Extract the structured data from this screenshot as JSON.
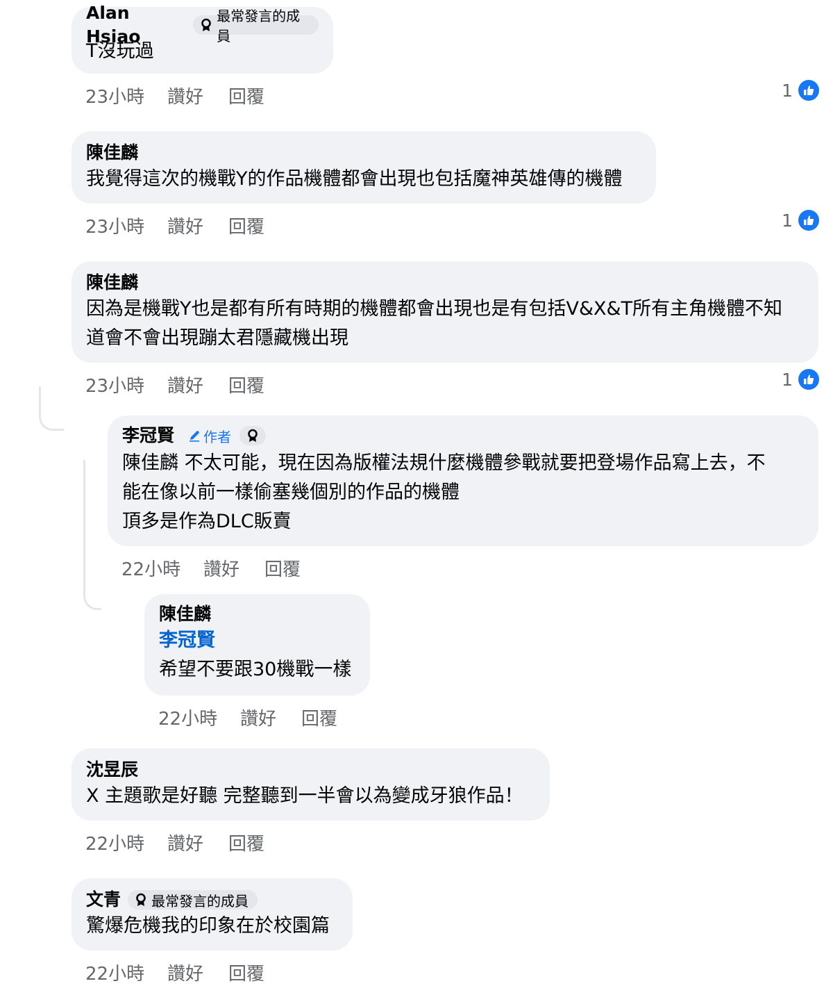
{
  "comments": [
    {
      "author": "Alan Hsiao",
      "badge": "最常發言的成員",
      "lines": "T沒玩過",
      "time": "23小時",
      "like": "讚好",
      "reply": "回覆",
      "reactions": "1"
    },
    {
      "author": "陳佳麟",
      "lines": "我覺得這次的機戰Y的作品機體都會出現也包括魔神英雄傳的機體",
      "time": "23小時",
      "like": "讚好",
      "reply": "回覆",
      "reactions": "1"
    },
    {
      "author": "陳佳麟",
      "lines": "因為是機戰Y也是都有所有時期的機體都會出現也是有包括V&X&T所有主角機體不知\n道會不會出現蹦太君隱藏機出現",
      "time": "23小時",
      "like": "讚好",
      "reply": "回覆",
      "reactions": "1"
    },
    {
      "author": "李冠賢",
      "author_badge": "作者",
      "lines": "陳佳麟 不太可能，現在因為版權法規什麼機體參戰就要把登場作品寫上去，不\n能在像以前一樣偷塞幾個別的作品的機體\n頂多是作為DLC販賣",
      "time": "22小時",
      "like": "讚好",
      "reply": "回覆"
    },
    {
      "author": "陳佳麟",
      "mention": "李冠賢",
      "lines": "希望不要跟30機戰一樣",
      "time": "22小時",
      "like": "讚好",
      "reply": "回覆"
    },
    {
      "author": "沈昱辰",
      "lines": "X 主題歌是好聽 完整聽到一半會以為變成牙狼作品！",
      "time": "22小時",
      "like": "讚好",
      "reply": "回覆"
    },
    {
      "author": "文青",
      "badge": "最常發言的成員",
      "lines": "驚爆危機我的印象在於校園篇",
      "time": "22小時",
      "like": "讚好",
      "reply": "回覆"
    }
  ],
  "colors": {
    "bubble": "#f0f2f5",
    "meta": "#65676b",
    "like_blue": "#1877f2",
    "mention": "#0064d1"
  },
  "icons": [
    "ribbon-badge-icon",
    "pencil-icon",
    "thumbs-up-icon"
  ]
}
